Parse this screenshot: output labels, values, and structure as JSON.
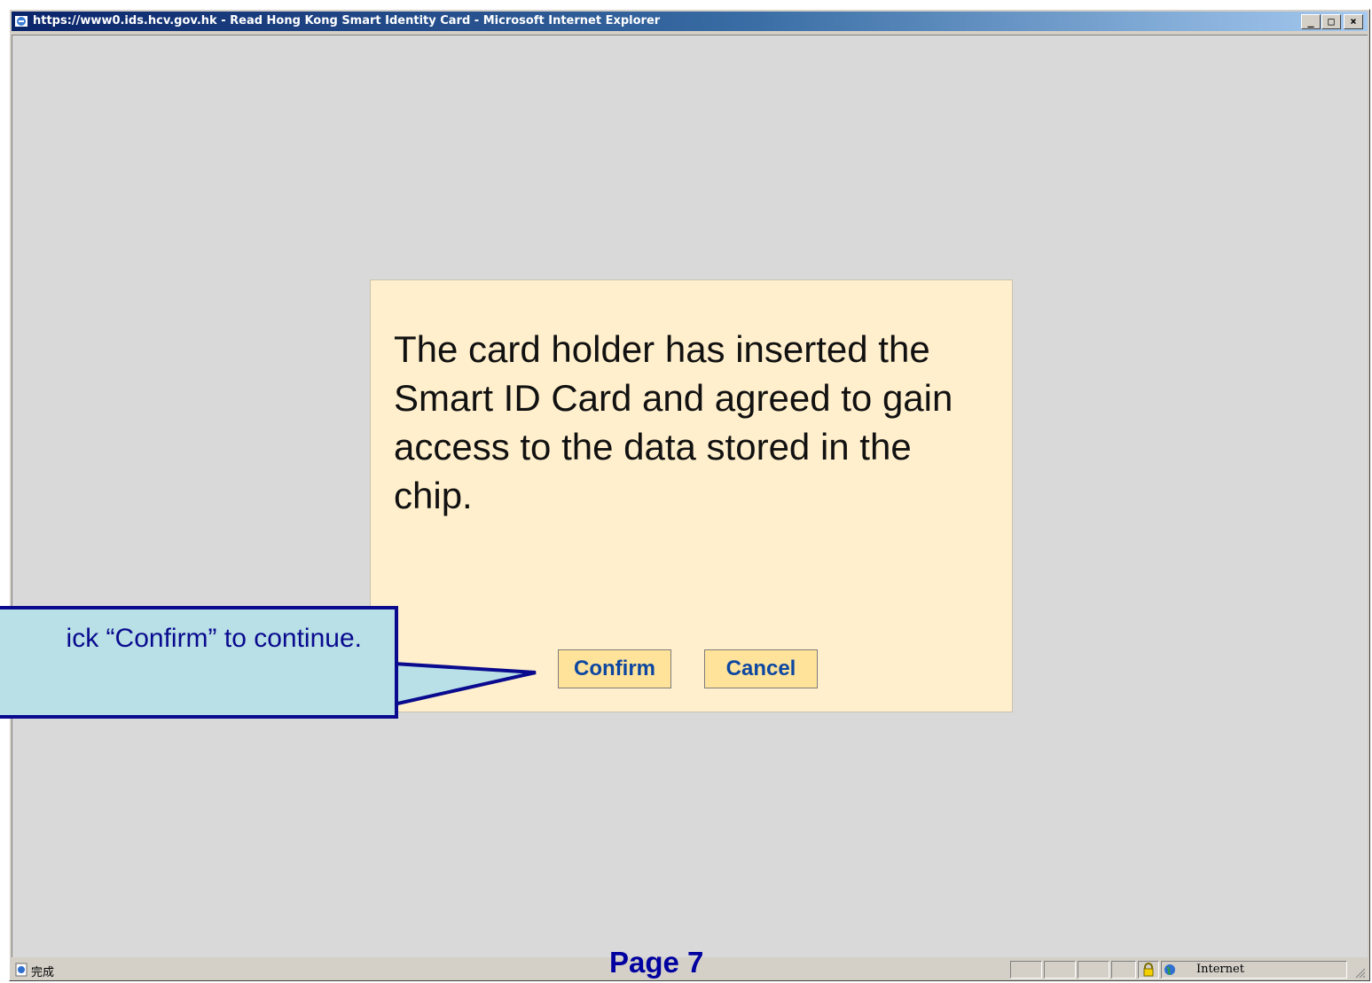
{
  "window": {
    "title": "https://www0.ids.hcv.gov.hk - Read Hong Kong Smart Identity Card - Microsoft Internet Explorer",
    "minimize": "_",
    "maximize": "□",
    "close": "×"
  },
  "dialog": {
    "message": "The card holder has inserted the Smart ID Card and agreed to gain access to the data stored in the chip.",
    "confirm_label": "Confirm",
    "cancel_label": "Cancel",
    "background": "#ffefcc",
    "button_color": "#ffe39a"
  },
  "callout": {
    "text": "ick “Confirm” to continue."
  },
  "statusbar": {
    "status_text": "完成",
    "zone": "Internet"
  },
  "slide": {
    "page_label": "Page 7"
  },
  "icons": {
    "ie": "ie-icon",
    "status": "ie-page-icon",
    "lock": "lock-icon",
    "zone": "globe-icon",
    "grip": "resize-grip-icon"
  }
}
